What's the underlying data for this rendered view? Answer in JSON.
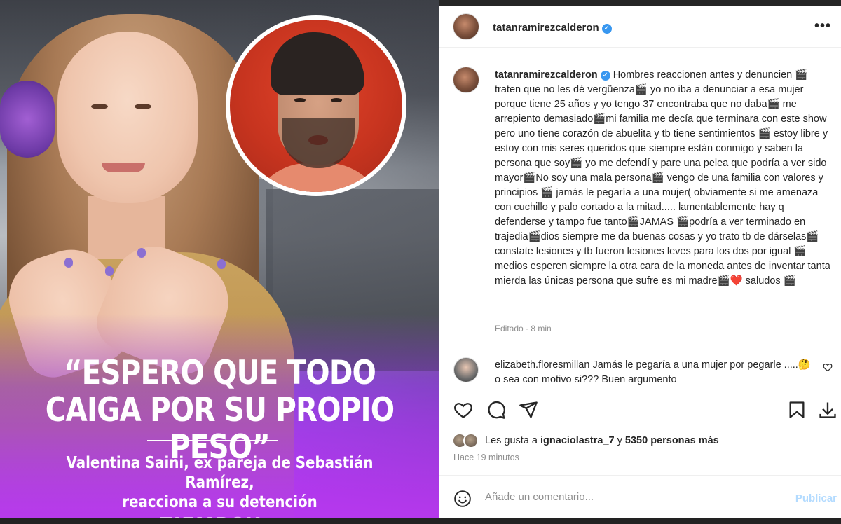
{
  "image_panel": {
    "headline": "“ESPERO QUE TODO CAIGA POR SU PROPIO PESO”",
    "subline_1": "Valentina Saini, ex pareja de Sebastián Ramírez,",
    "subline_2": "reacciona a su detención",
    "brand": "TIEMPOX"
  },
  "post": {
    "username": "tatanramirezcalderon",
    "verified_mark": "✓",
    "more_label": "•••",
    "caption_user": "tatanramirezcalderon",
    "caption_text": "Hombres reaccionen antes y denuncien 🎬 traten que no les dé vergüenza🎬 yo no iba a denunciar a esa mujer porque tiene 25 años y yo tengo 37 encontraba que no daba🎬 me arrepiento demasiado🎬mi familia me decía que terminara con este show pero uno tiene corazón de abuelita y tb tiene sentimientos 🎬 estoy libre y estoy con mis seres queridos que siempre están conmigo y saben la persona que soy🎬 yo me defendí y pare una pelea que podría a ver sido mayor🎬No soy una mala persona🎬 vengo de una familia con valores y principios 🎬 jamás le pegaría a una mujer( obviamente si me amenaza con cuchillo y palo cortado a la mitad..... lamentablemente hay q defenderse y tampo fue tanto🎬JAMAS 🎬podría a ver terminado en trajedia🎬dios siempre me da buenas cosas y yo trato tb de dárselas🎬 constate lesiones y tb fueron lesiones leves para los dos por igual 🎬 medios esperen siempre la otra cara de la moneda antes de inventar tanta mierda las únicas persona que sufre es mi madre🎬❤️ saludos 🎬",
    "edited_meta": "Editado · 8 min",
    "comment_user": "elizabeth.floresmillan",
    "comment_text": "Jamás le pegaría a una mujer por pegarle .....🤔 o sea con motivo si??? Buen argumento",
    "likes_prefix": "Les gusta a",
    "likes_user": "ignaciolastra_7",
    "likes_mid": "y",
    "likes_count": "5350 personas más",
    "posted_ago": "Hace 19 minutos",
    "comment_placeholder": "Añade un comentario...",
    "publish_label": "Publicar"
  },
  "icons": [
    "more-icon",
    "verified-icon",
    "like-heart-icon",
    "comment-icon",
    "share-icon",
    "save-bookmark-icon",
    "download-icon",
    "emoji-icon",
    "comment-like-icon"
  ],
  "colors": {
    "accent_blue": "#3897f0",
    "publish_disabled": "#b3dbff",
    "banner_purple": "#b43df0"
  }
}
